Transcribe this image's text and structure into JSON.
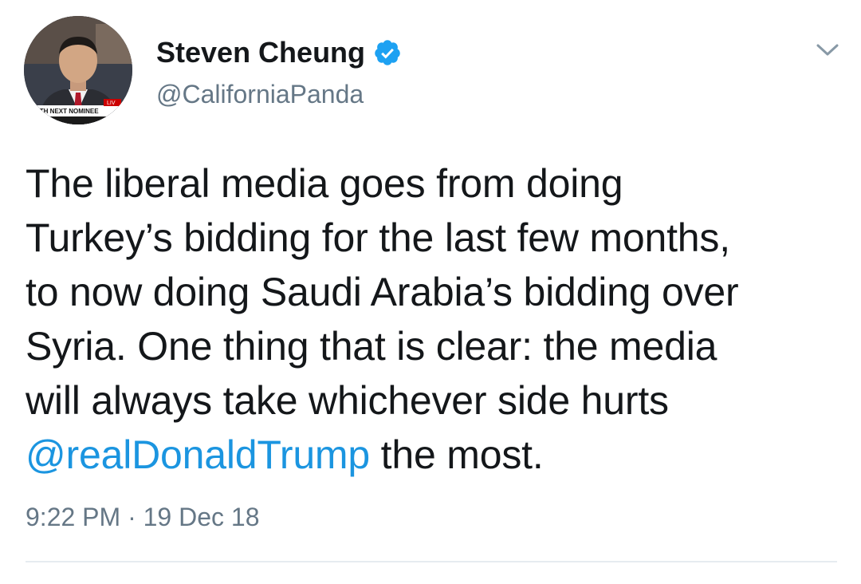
{
  "author": {
    "display_name": "Steven Cheung",
    "handle": "@CaliforniaPanda",
    "verified": true,
    "avatar_caption": "WITH NEXT NOMINEE",
    "avatar_live": "LIV"
  },
  "tweet": {
    "lines": [
      "The liberal media goes from doing",
      "Turkey’s bidding for the last few months,",
      "to now doing Saudi Arabia’s bidding over",
      "Syria. One thing that is clear: the media",
      "will always take whichever side hurts"
    ],
    "mention": "@realDonaldTrump",
    "last_line_rest": " the most."
  },
  "meta": {
    "time": "9:22 PM",
    "separator": " · ",
    "date": "19 Dec 18"
  },
  "colors": {
    "link": "#1b95e0",
    "verified": "#1da1f2",
    "secondary_text": "#657786",
    "divider": "#e6ecf0"
  },
  "icons": {
    "verified": "verified-badge-icon",
    "menu": "chevron-down-icon"
  }
}
